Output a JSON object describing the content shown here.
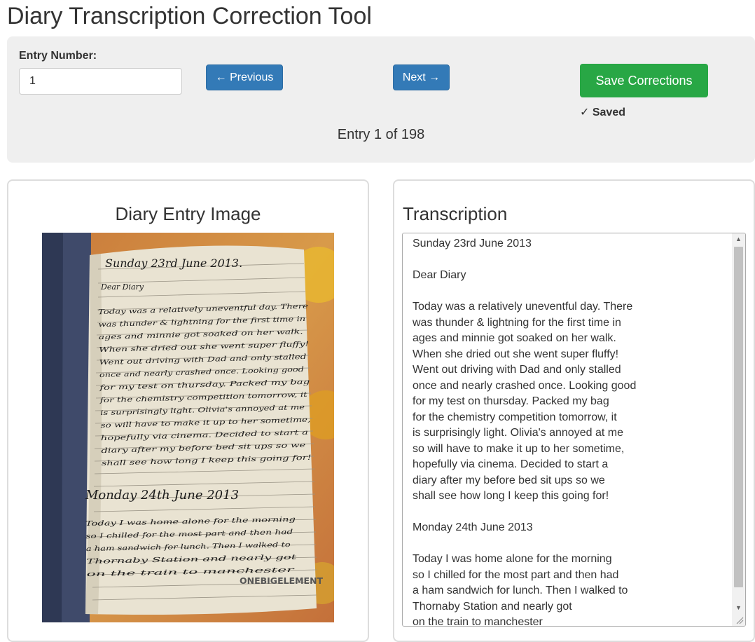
{
  "header": {
    "title": "Diary Transcription Correction Tool"
  },
  "controls": {
    "entry_label": "Entry Number:",
    "entry_value": "1",
    "prev_label": "← Previous",
    "next_label": "Next →",
    "save_label": "Save Corrections",
    "saved_status": "✓ Saved",
    "entry_counter": "Entry 1 of 198"
  },
  "image_panel": {
    "title": "Diary Entry Image"
  },
  "transcription_panel": {
    "title": "Transcription",
    "text": "Sunday 23rd June 2013\n\nDear Diary\n\nToday was a relatively uneventful day. There\nwas thunder & lightning for the first time in\nages and minnie got soaked on her walk.\nWhen she dried out she went super fluffy!\nWent out driving with Dad and only stalled\nonce and nearly crashed once. Looking good\nfor my test on thursday. Packed my bag\nfor the chemistry competition tomorrow, it\nis surprisingly light. Olivia's annoyed at me\nso will have to make it up to her sometime,\nhopefully via cinema. Decided to start a\ndiary after my before bed sit ups so we\nshall see how long I keep this going for!\n\nMonday 24th June 2013\n\nToday I was home alone for the morning\nso I chilled for the most part and then had\na ham sandwich for lunch. Then I walked to\nThornaby Station and nearly got\non the train to manchester"
  },
  "diary_image": {
    "heading1": "Sunday 23rd June 2013.",
    "greeting": "Dear Diary",
    "lines1": [
      "Today was a relatively uneventful day. There",
      "was thunder & lightning for the first time in",
      "ages and minnie got soaked on her walk.",
      "When she dried out she went super fluffy!",
      "Went out driving with Dad and only stalled",
      "once and nearly crashed once. Looking good",
      "for my test on thursday. Packed my bag",
      "for the chemistry competition tomorrow, it",
      "is surprisingly light. Olivia's annoyed at me",
      "so will have to make it up to her sometime,",
      "hopefully via cinema. Decided to start a",
      "diary after my before bed sit ups so we",
      "shall see how long I keep this going for!"
    ],
    "heading2": "Monday 24th June 2013",
    "lines2": [
      "Today I was home alone for the morning",
      "so I chilled for the most part and then had",
      "a ham sandwich for lunch. Then I walked to",
      "Thornaby Station and nearly got",
      "on the train to manchester"
    ],
    "brand": "ONEBIGELEMENT"
  },
  "colors": {
    "primary": "#337ab7",
    "success": "#28a745",
    "panel_bg": "#efefef"
  }
}
